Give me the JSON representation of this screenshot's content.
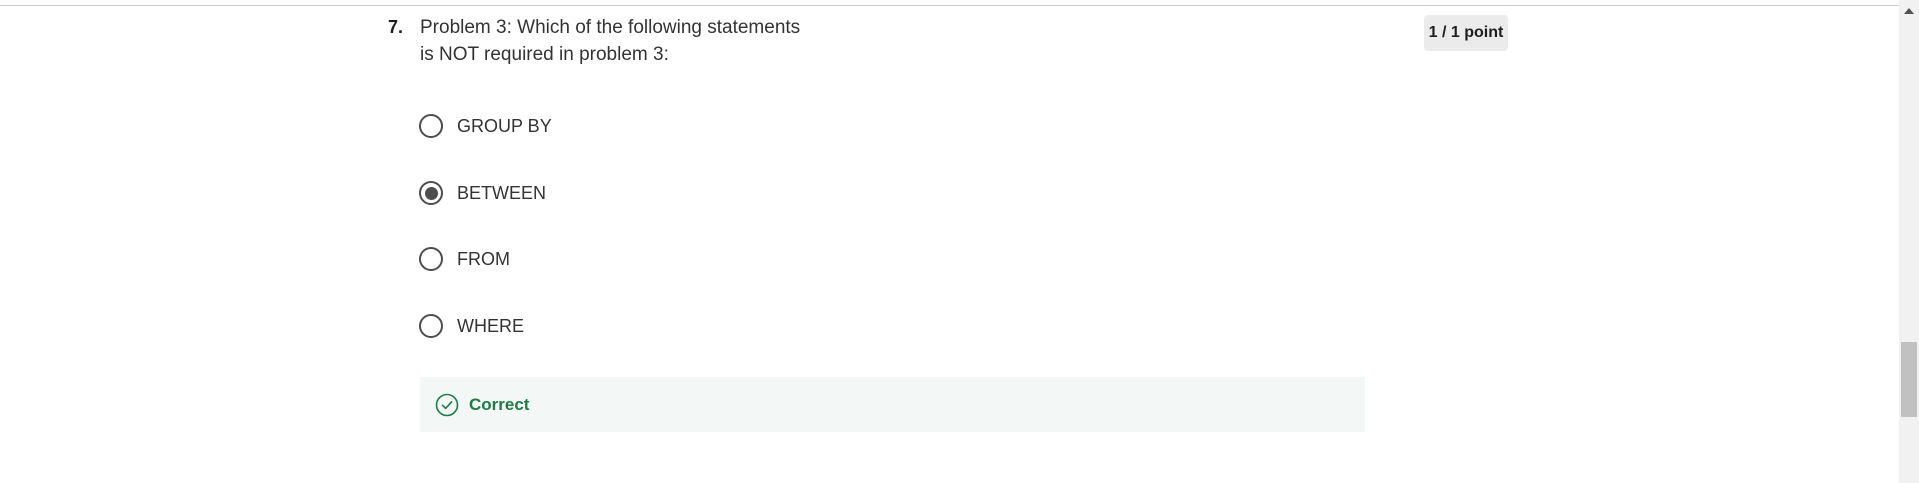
{
  "question": {
    "number": "7.",
    "text_line1": "Problem 3: Which of the following statements",
    "text_line2": "is NOT required in problem 3:",
    "score": "1 / 1 point"
  },
  "options": [
    {
      "label": "GROUP BY",
      "selected": false
    },
    {
      "label": "BETWEEN",
      "selected": true
    },
    {
      "label": "FROM",
      "selected": false
    },
    {
      "label": "WHERE",
      "selected": false
    }
  ],
  "feedback": {
    "label": "Correct",
    "icon": "check-circle-icon",
    "color": "#1f7a45"
  },
  "colors": {
    "radio": "#4d4d4d",
    "feedback_bg": "#f3f8f6",
    "score_bg": "#ebebeb"
  }
}
